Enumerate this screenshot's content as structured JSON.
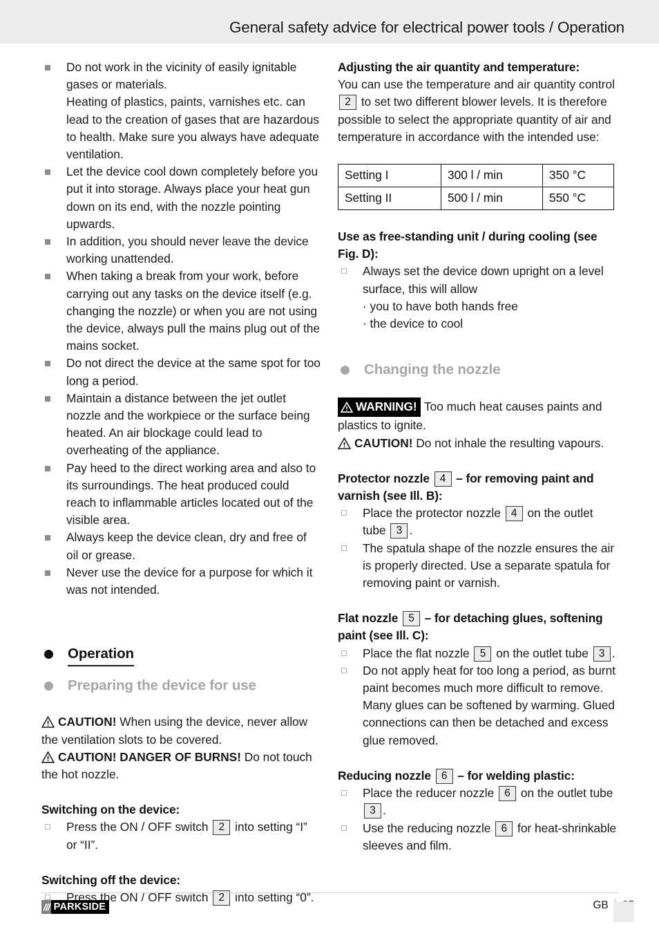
{
  "header": {
    "title": "General safety advice for electrical power tools / Operation"
  },
  "left_column": {
    "safety_bullets": [
      "Do not work in the vicinity of easily ignitable gases or materials.\nHeating of plastics, paints, varnishes etc. can lead to the creation of gases that are hazardous to health. Make sure you always have adequate ventilation.",
      "Let the device cool down completely before you put it into storage. Always place your heat gun down on its end, with the nozzle pointing upwards.",
      "In addition, you should never leave the device working unattended.",
      "When taking a break from your work, before carrying out any tasks on the device itself (e.g. changing the nozzle) or when you are not using the device, always pull the mains plug out of the mains socket.",
      "Do not direct the device at the same spot for too long a period.",
      "Maintain a distance between the jet outlet nozzle and the workpiece or the surface being heated. An air blockage could lead to overheating of the appliance.",
      "Pay heed to the direct working area and also to its surroundings. The heat produced could reach to inflammable articles located out of the visible area.",
      "Always keep the device clean, dry and free of oil or grease.",
      "Never use the device for a purpose for which it was not intended."
    ],
    "operation_heading": "Operation",
    "preparing_heading": "Preparing the device for use",
    "caution_1_label": "CAUTION!",
    "caution_1_text": " When using the device, never allow the ventilation slots to be covered.",
    "caution_2_label": "CAUTION! DANGER OF BURNS!",
    "caution_2_text": " Do not touch the hot nozzle.",
    "switch_on_heading": "Switching on the device:",
    "switch_on_text_a": "Press the ON / OFF switch",
    "switch_on_ref": "2",
    "switch_on_text_b": "into setting “I” or “II”.",
    "switch_off_heading": "Switching off the device:",
    "switch_off_text_a": "Press the ON / OFF switch",
    "switch_off_ref": "2",
    "switch_off_text_b": "into setting “0”."
  },
  "right_column": {
    "adjust_heading": "Adjusting the air quantity and temperature:",
    "adjust_text_a": "You can use the temperature and air quantity control",
    "adjust_ref": "2",
    "adjust_text_b": "to set two different blower levels. It is therefore possible to select the appropriate quantity of air and temperature in accordance with the intended use:",
    "settings_table": {
      "rows": [
        [
          "Setting I",
          "300 l / min",
          "350 °C"
        ],
        [
          "Setting II",
          "500 l / min",
          "550 °C"
        ]
      ]
    },
    "freestanding_heading": "Use as free-standing unit / during cooling (see Fig. D):",
    "freestanding_bullet": "Always set the device down upright on a level surface, this will allow",
    "freestanding_sub": [
      "· you to have both hands free",
      "· the device to cool"
    ],
    "changing_nozzle_heading": "Changing the nozzle",
    "warning_label": "WARNING!",
    "warning_text": " Too much heat causes paints and plastics to ignite.",
    "caution_label": "CAUTION!",
    "caution_text": " Do not inhale the resulting vapours.",
    "protector_heading_a": "Protector nozzle",
    "protector_ref": "4",
    "protector_heading_b": "– for removing paint and varnish (see Ill. B):",
    "protector_b1_a": "Place the protector nozzle",
    "protector_b1_ref1": "4",
    "protector_b1_b": "on the outlet tube",
    "protector_b1_ref2": "3",
    "protector_b1_c": ".",
    "protector_b2": "The spatula shape of the nozzle ensures the air is properly directed. Use a separate spatula for removing paint or varnish.",
    "flat_heading_a": "Flat nozzle",
    "flat_ref": "5",
    "flat_heading_b": "– for detaching glues, softening paint (see Ill. C):",
    "flat_b1_a": "Place the flat nozzle",
    "flat_b1_ref1": "5",
    "flat_b1_b": "on the outlet tube",
    "flat_b1_ref2": "3",
    "flat_b1_c": ".",
    "flat_b2": "Do not apply heat for too long a period, as burnt paint becomes much more difficult to remove. Many glues can be softened by warming. Glued connections can then be detached and excess glue removed.",
    "reducing_heading_a": "Reducing nozzle",
    "reducing_ref": "6",
    "reducing_heading_b": "– for welding plastic:",
    "reducing_b1_a": "Place the reducer nozzle",
    "reducing_b1_ref1": "6",
    "reducing_b1_b": "on the outlet tube",
    "reducing_b1_ref2": "3",
    "reducing_b1_c": ".",
    "reducing_b2_a": "Use the reducing nozzle",
    "reducing_b2_ref": "6",
    "reducing_b2_b": "for heat-shrinkable sleeves and film."
  },
  "footer": {
    "logo_slashes": "///",
    "logo_name": "PARKSIDE",
    "locale": "GB",
    "page_number": "25"
  },
  "colors": {
    "header_band": "#ededed",
    "heading_gray": "#a6a6a6",
    "bullet_gray": "#8a8a8a",
    "numbox_fill": "#ececec",
    "text": "#1a1a1a"
  }
}
